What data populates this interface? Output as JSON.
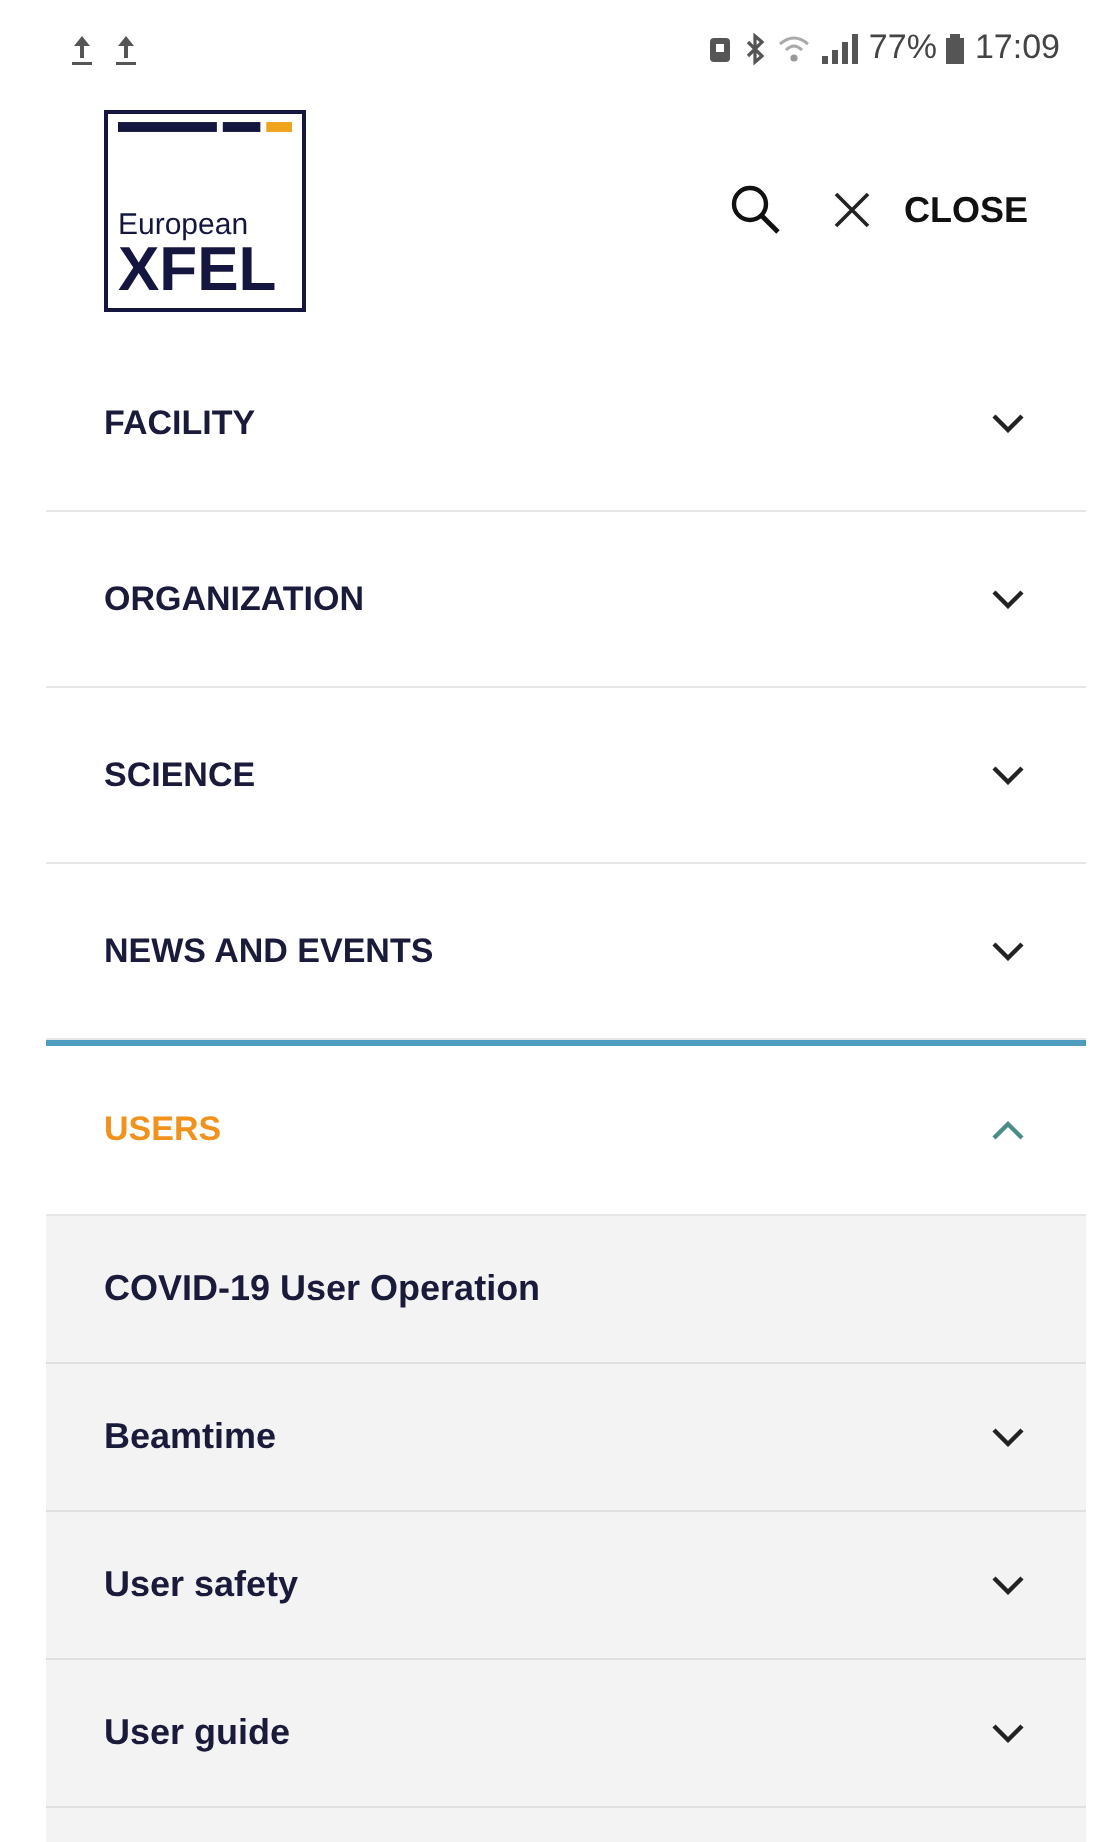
{
  "status_bar": {
    "battery": "77%",
    "time": "17:09"
  },
  "logo": {
    "line_1": "European",
    "line_2": "XFEL"
  },
  "header": {
    "close_label": "CLOSE"
  },
  "menu": [
    {
      "label": "FACILITY",
      "expanded": false
    },
    {
      "label": "ORGANIZATION",
      "expanded": false
    },
    {
      "label": "SCIENCE",
      "expanded": false
    },
    {
      "label": "NEWS AND EVENTS",
      "expanded": false
    },
    {
      "label": "USERS",
      "expanded": true,
      "children": [
        {
          "label": "COVID-19 User Operation",
          "kind": "link"
        },
        {
          "label": "Beamtime",
          "kind": "dropdown"
        },
        {
          "label": "User safety",
          "kind": "dropdown"
        },
        {
          "label": "User guide",
          "kind": "dropdown"
        }
      ]
    }
  ]
}
